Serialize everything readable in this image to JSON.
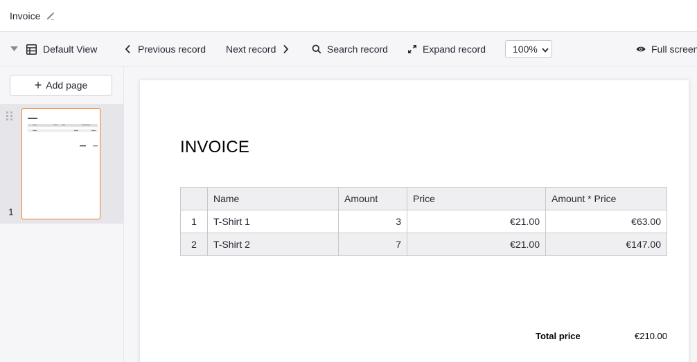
{
  "titlebar": {
    "title": "Invoice",
    "edit_icon": "pencil-icon"
  },
  "toolbar": {
    "view_label": "Default View",
    "previous_label": "Previous record",
    "next_label": "Next record",
    "search_label": "Search record",
    "expand_label": "Expand record",
    "zoom": "100%",
    "fullscreen_label": "Full screen"
  },
  "sidebar": {
    "add_page_label": "Add page",
    "pages": [
      {
        "number": "1"
      }
    ]
  },
  "document": {
    "heading": "INVOICE",
    "columns": [
      "",
      "Name",
      "Amount",
      "Price",
      "Amount * Price"
    ],
    "rows": [
      {
        "index": "1",
        "name": "T-Shirt 1",
        "amount": "3",
        "price": "€21.00",
        "total": "€63.00"
      },
      {
        "index": "2",
        "name": "T-Shirt 2",
        "amount": "7",
        "price": "€21.00",
        "total": "€147.00"
      }
    ],
    "total_label": "Total price",
    "total_value": "€210.00"
  },
  "colors": {
    "accent": "#f07a28",
    "header_bg": "#efeff1",
    "toolbar_bg": "#f6f6f8"
  }
}
